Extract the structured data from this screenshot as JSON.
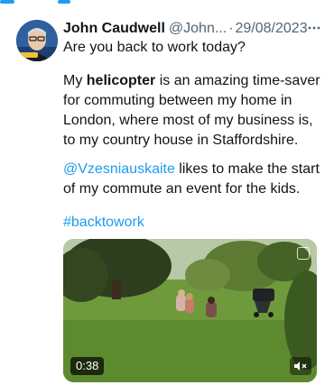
{
  "tweet": {
    "author_name": "John Caudwell",
    "handle": "@John...",
    "separator": "·",
    "date": "29/08/2023",
    "line1": "Are you back to work today?",
    "p2_before": "My ",
    "p2_bold": "helicopter",
    "p2_after": " is an amazing time-saver for commuting between my home in London, where most of my business is, to my country house in Staffordshire.",
    "p3_mention": "@Vzesniauskaite",
    "p3_after": " likes to make the start of my commute an event for the kids.",
    "hashtag": "#backtowork"
  },
  "media": {
    "duration": "0:38"
  },
  "icons": {
    "more": "more-horizontal-icon",
    "mute": "speaker-muted-icon",
    "expand": "expand-icon"
  },
  "colors": {
    "link": "#1d9bf0",
    "secondary_text": "#536471",
    "primary_text": "#0f1419"
  }
}
